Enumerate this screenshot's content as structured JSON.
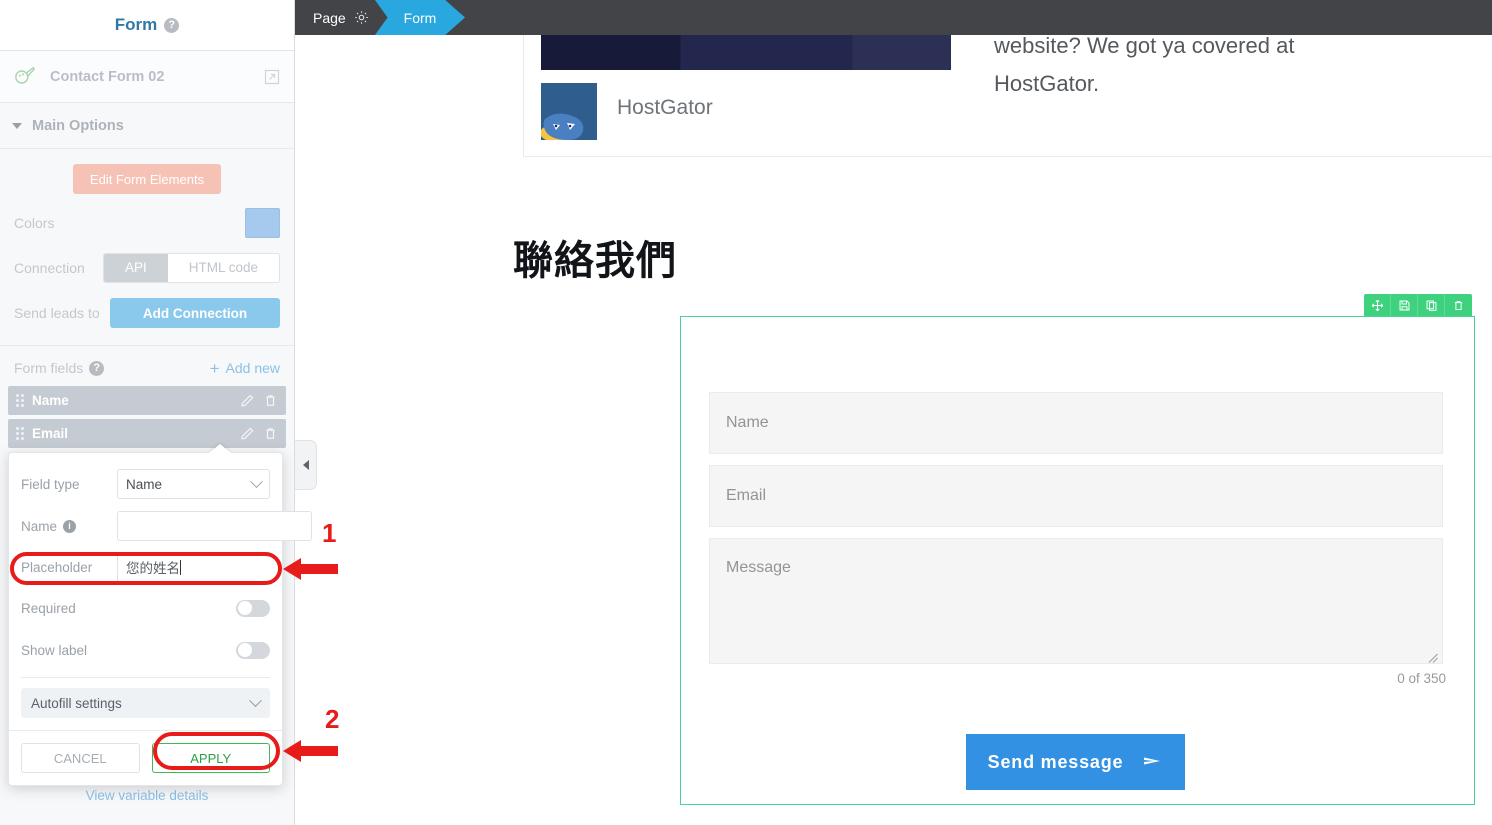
{
  "sidebar": {
    "header": {
      "title": "Form",
      "help_icon": "help-circle-icon"
    },
    "form_row": {
      "icon": "palette-brush-icon",
      "label": "Contact Form 02",
      "open_icon": "external-link-icon"
    },
    "section": {
      "label": "Main Options",
      "caret_icon": "caret-down-icon"
    },
    "edit_elements_label": "Edit Form Elements",
    "colors": {
      "label": "Colors",
      "swatch_hex": "#a6caed"
    },
    "connection": {
      "label": "Connection",
      "options": [
        "API",
        "HTML code"
      ],
      "selected": "API"
    },
    "send_leads": {
      "label": "Send leads to",
      "button_label": "Add Connection"
    },
    "form_fields": {
      "label": "Form fields",
      "help_icon": "help-circle-icon",
      "add_new_label": "Add new",
      "plus_icon": "plus-icon",
      "items": [
        {
          "label": "Name",
          "edit_icon": "pencil-icon",
          "delete_icon": "trash-icon"
        },
        {
          "label": "Email",
          "edit_icon": "pencil-icon",
          "delete_icon": "trash-icon"
        }
      ]
    },
    "view_variable_details": "View variable details",
    "collapse_icon": "caret-left-icon"
  },
  "popup": {
    "field_type": {
      "label": "Field type",
      "value": "Name",
      "chevron_icon": "chevron-down-icon"
    },
    "name": {
      "label": "Name",
      "info_icon": "info-circle-icon",
      "value": ""
    },
    "placeholder": {
      "label": "Placeholder",
      "value": "您的姓名"
    },
    "required": {
      "label": "Required",
      "state": "off"
    },
    "show_label": {
      "label": "Show label",
      "state": "off"
    },
    "autofill": {
      "label": "Autofill settings",
      "chevron_icon": "chevron-down-icon"
    },
    "cancel_label": "CANCEL",
    "apply_label": "APPLY"
  },
  "annotations": {
    "step1": "1",
    "step2": "2",
    "highlight_hex": "#e81b1b"
  },
  "topbar": {
    "page_crumb": {
      "label": "Page",
      "gear_icon": "gear-icon"
    },
    "form_crumb": {
      "label": "Form"
    },
    "accent_hex": "#29a8e0"
  },
  "canvas": {
    "promo": {
      "brand": "HostGator",
      "text": "website? We got ya covered at HostGator.",
      "logo_icon": "hostgator-alligator-logo"
    },
    "page_title": "聯絡我們",
    "form_widget": {
      "toolbar": [
        {
          "icon": "move-icon",
          "name": "move-handle"
        },
        {
          "icon": "save-icon",
          "name": "save-button"
        },
        {
          "icon": "duplicate-icon",
          "name": "duplicate-button"
        },
        {
          "icon": "trash-icon",
          "name": "delete-button"
        }
      ],
      "fields": [
        {
          "name": "name",
          "placeholder": "Name"
        },
        {
          "name": "email",
          "placeholder": "Email"
        },
        {
          "name": "message",
          "placeholder": "Message"
        }
      ],
      "char_counter": "0 of 350",
      "submit_label": "Send message",
      "submit_icon": "send-arrow-icon",
      "submit_hex": "#3391e3",
      "border_hex": "#4ad295"
    }
  }
}
